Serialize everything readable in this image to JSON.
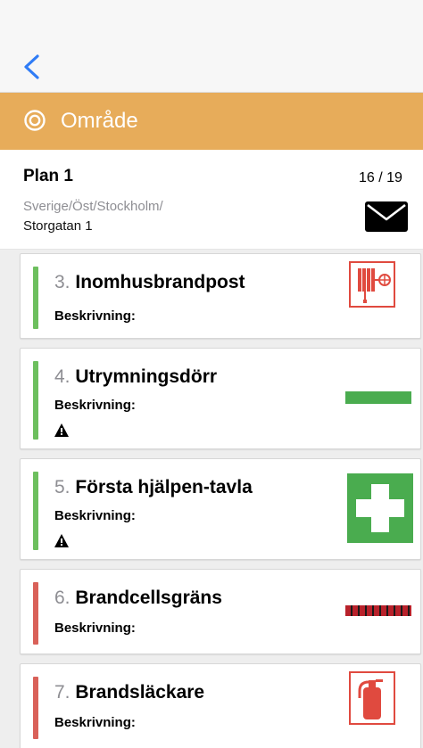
{
  "nav": {
    "back_icon": "chevron-left-icon"
  },
  "area": {
    "icon": "target-icon",
    "title": "Område",
    "color": "#e7ac5a"
  },
  "plan": {
    "title": "Plan 1",
    "path": "Sverige/Öst/Stockholm/",
    "street": "Storgatan 1",
    "count": "16 / 19",
    "mail_icon": "envelope-icon"
  },
  "items": [
    {
      "number": "3.",
      "name": "Inomhusbrandpost",
      "description_label": "Beskrivning:",
      "status": "green",
      "warning": false,
      "icon": "fire-hose-reel-icon"
    },
    {
      "number": "4.",
      "name": "Utrymningsdörr",
      "description_label": "Beskrivning:",
      "status": "green",
      "warning": true,
      "icon": "green-line-icon"
    },
    {
      "number": "5.",
      "name": "Första hjälpen-tavla",
      "description_label": "Beskrivning:",
      "status": "green",
      "warning": true,
      "icon": "first-aid-cross-icon"
    },
    {
      "number": "6.",
      "name": "Brandcellsgräns",
      "description_label": "Beskrivning:",
      "status": "red",
      "warning": false,
      "icon": "fire-compartment-line-icon"
    },
    {
      "number": "7.",
      "name": "Brandsläckare",
      "description_label": "Beskrivning:",
      "status": "red",
      "warning": false,
      "icon": "fire-extinguisher-icon"
    }
  ],
  "colors": {
    "green": "#6dbf5e",
    "red": "#d96159",
    "symbol_red": "#e04a3f",
    "symbol_green": "#4aac4f",
    "link_blue": "#2f7cf6"
  }
}
